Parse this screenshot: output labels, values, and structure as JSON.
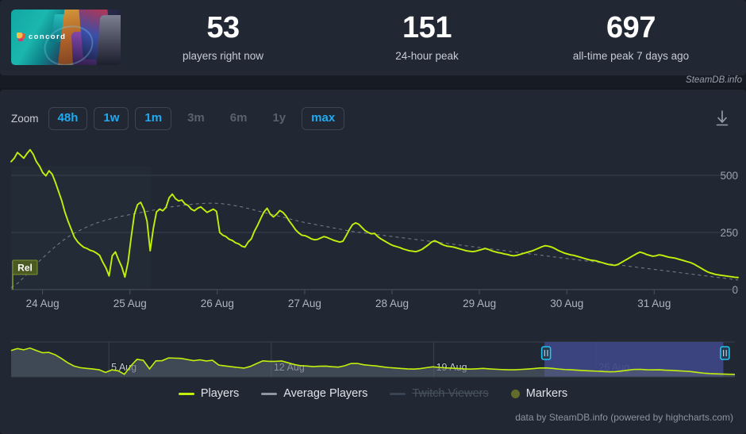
{
  "header": {
    "capsule": {
      "game_title": "concord",
      "icon": "game-capsule-image"
    },
    "stats": [
      {
        "id": "players-now",
        "value": "53",
        "label": "players right now"
      },
      {
        "id": "peak-24h",
        "value": "151",
        "label": "24-hour peak"
      },
      {
        "id": "all-time-peak",
        "value": "697",
        "label": "all-time peak 7 days ago"
      }
    ],
    "watermark": "SteamDB.info"
  },
  "toolbar": {
    "zoom_label": "Zoom",
    "buttons": [
      {
        "label": "48h",
        "state": "active"
      },
      {
        "label": "1w",
        "state": "active"
      },
      {
        "label": "1m",
        "state": "active"
      },
      {
        "label": "3m",
        "state": "dim"
      },
      {
        "label": "6m",
        "state": "dim"
      },
      {
        "label": "1y",
        "state": "dim"
      },
      {
        "label": "max",
        "state": "outlined"
      }
    ],
    "download_icon": "download-icon"
  },
  "chart_data": {
    "type": "line",
    "title": "",
    "xlabel": "",
    "ylabel": "",
    "ylim": [
      0,
      625
    ],
    "yticks": [
      0,
      250,
      500
    ],
    "ytick_labels": [
      "0",
      "250",
      "500"
    ],
    "grid": true,
    "legend_position": "bottom",
    "xtick_labels": [
      "24 Aug",
      "25 Aug",
      "26 Aug",
      "27 Aug",
      "28 Aug",
      "29 Aug",
      "30 Aug",
      "31 Aug"
    ],
    "x_start": "23 Aug",
    "x_end": "31 Aug",
    "annotations": [
      {
        "type": "flag",
        "label": "Rel",
        "x": "23 Aug",
        "color": "#4a5a22"
      }
    ],
    "series": [
      {
        "name": "Players",
        "color": "#c3f00a",
        "style": "solid",
        "values": [
          560,
          575,
          600,
          588,
          575,
          595,
          612,
          592,
          560,
          540,
          512,
          498,
          520,
          505,
          470,
          430,
          390,
          340,
          300,
          265,
          230,
          210,
          196,
          185,
          180,
          172,
          168,
          160,
          150,
          120,
          95,
          60,
          148,
          165,
          130,
          100,
          55,
          120,
          230,
          330,
          372,
          382,
          352,
          300,
          170,
          268,
          340,
          352,
          345,
          360,
          402,
          418,
          398,
          388,
          392,
          375,
          368,
          352,
          345,
          356,
          362,
          350,
          338,
          345,
          352,
          342,
          250,
          238,
          232,
          220,
          215,
          205,
          200,
          190,
          186,
          208,
          222,
          256,
          282,
          312,
          340,
          356,
          330,
          318,
          330,
          346,
          338,
          322,
          300,
          282,
          262,
          248,
          238,
          236,
          230,
          222,
          218,
          220,
          226,
          232,
          228,
          222,
          216,
          212,
          208,
          212,
          236,
          262,
          284,
          292,
          286,
          272,
          258,
          250,
          244,
          246,
          232,
          222,
          214,
          206,
          198,
          192,
          188,
          184,
          178,
          174,
          170,
          168,
          166,
          170,
          176,
          186,
          196,
          208,
          214,
          208,
          200,
          194,
          190,
          188,
          186,
          182,
          178,
          174,
          170,
          168,
          166,
          168,
          172,
          176,
          180,
          176,
          170,
          166,
          162,
          160,
          156,
          154,
          150,
          148,
          150,
          154,
          158,
          162,
          166,
          170,
          176,
          182,
          188,
          192,
          190,
          186,
          180,
          172,
          166,
          160,
          156,
          152,
          150,
          146,
          142,
          138,
          134,
          130,
          128,
          126,
          122,
          118,
          114,
          110,
          108,
          106,
          110,
          118,
          126,
          134,
          142,
          150,
          158,
          164,
          160,
          154,
          150,
          146,
          148,
          152,
          150,
          146,
          142,
          140,
          138,
          134,
          130,
          126,
          122,
          118,
          112,
          104,
          96,
          88,
          80,
          74,
          70,
          66,
          64,
          62,
          60,
          58,
          56,
          54,
          53
        ]
      },
      {
        "name": "Average Players",
        "color": "#8f96a3",
        "style": "dashed",
        "values": [
          8,
          30,
          62,
          96,
          128,
          158,
          186,
          212,
          234,
          252,
          268,
          282,
          294,
          304,
          312,
          320,
          326,
          332,
          338,
          344,
          350,
          356,
          362,
          366,
          370,
          374,
          376,
          378,
          378,
          376,
          372,
          366,
          360,
          352,
          344,
          336,
          328,
          320,
          312,
          304,
          296,
          290,
          284,
          278,
          272,
          266,
          260,
          254,
          250,
          246,
          242,
          238,
          234,
          230,
          226,
          222,
          218,
          214,
          210,
          206,
          202,
          198,
          194,
          190,
          186,
          182,
          178,
          174,
          170,
          166,
          162,
          158,
          154,
          150,
          146,
          142,
          138,
          134,
          130,
          126,
          122,
          118,
          114,
          110,
          106,
          102,
          98,
          94,
          90,
          86,
          82,
          78,
          74,
          70,
          66,
          62,
          58,
          54,
          50,
          46,
          42
        ]
      },
      {
        "name": "Twitch Viewers",
        "color": "#3b4452",
        "style": "solid",
        "visible": false,
        "values": []
      }
    ]
  },
  "legend": [
    {
      "label": "Players",
      "marker": "line",
      "color": "#c3f00a",
      "enabled": true
    },
    {
      "label": "Average Players",
      "marker": "line",
      "color": "#8f96a3",
      "enabled": true
    },
    {
      "label": "Twitch Viewers",
      "marker": "line",
      "color": "#3b4452",
      "enabled": false
    },
    {
      "label": "Markers",
      "marker": "dot",
      "color": "#626b2a",
      "enabled": true
    }
  ],
  "navigator": {
    "tick_labels": [
      "5 Aug",
      "12 Aug",
      "19 Aug",
      "26 Aug"
    ],
    "selection": {
      "from_pct": 73.7,
      "to_pct": 98.4
    },
    "handle_left": "navigator-handle-left",
    "handle_right": "navigator-handle-right"
  },
  "footer": {
    "credit": "data by SteamDB.info (powered by highcharts.com)"
  }
}
